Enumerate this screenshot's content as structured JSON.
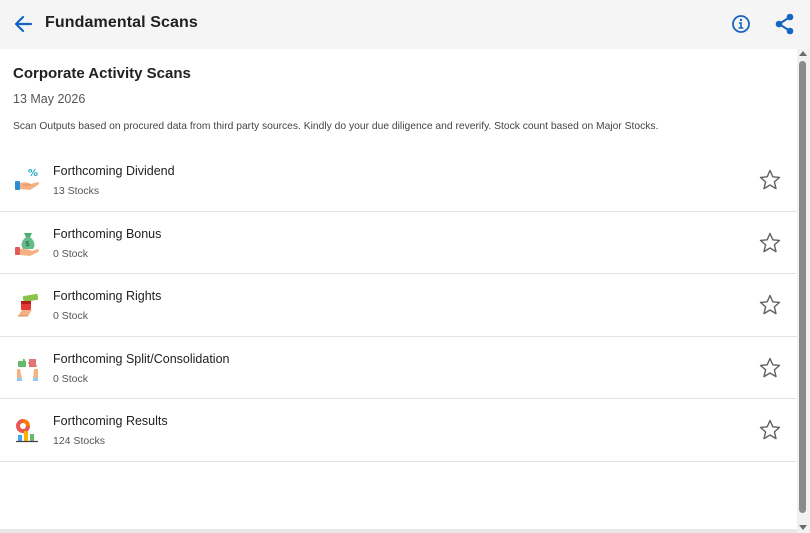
{
  "header": {
    "title": "Fundamental Scans",
    "back_icon": "arrow-left-icon",
    "info_icon": "info-circle-icon",
    "share_icon": "share-icon",
    "accent_color": "#1565c0"
  },
  "section": {
    "title": "Corporate Activity Scans",
    "date": "13 May 2026",
    "disclaimer": "Scan Outputs based on procured data from third party sources. Kindly do your due diligence and reverify. Stock count based on Major Stocks."
  },
  "scans": [
    {
      "title": "Forthcoming Dividend",
      "count": "13 Stocks",
      "icon": "dividend-hand-percent-icon"
    },
    {
      "title": "Forthcoming Bonus",
      "count": "0 Stock",
      "icon": "bonus-money-bag-icon"
    },
    {
      "title": "Forthcoming Rights",
      "count": "0 Stock",
      "icon": "rights-certificate-icon"
    },
    {
      "title": "Forthcoming Split/Consolidation",
      "count": "0 Stock",
      "icon": "split-puzzle-hands-icon"
    },
    {
      "title": "Forthcoming Results",
      "count": "124 Stocks",
      "icon": "results-chart-icon"
    }
  ]
}
